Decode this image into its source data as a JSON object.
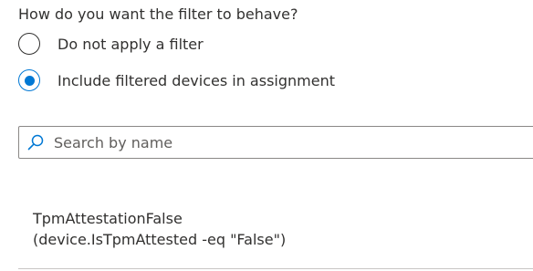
{
  "filter_behavior": {
    "question": "How do you want the filter to behave?",
    "options": [
      {
        "label": "Do not apply a filter",
        "selected": false
      },
      {
        "label": "Include filtered devices in assignment",
        "selected": true
      }
    ]
  },
  "search": {
    "placeholder": "Search by name",
    "value": "",
    "icon": "search-icon"
  },
  "filters": [
    {
      "name": "TpmAttestationFalse",
      "rule": "(device.IsTpmAttested -eq \"False\")"
    }
  ],
  "colors": {
    "accent": "#0078d4",
    "text": "#323130",
    "border": "#8a8886"
  }
}
